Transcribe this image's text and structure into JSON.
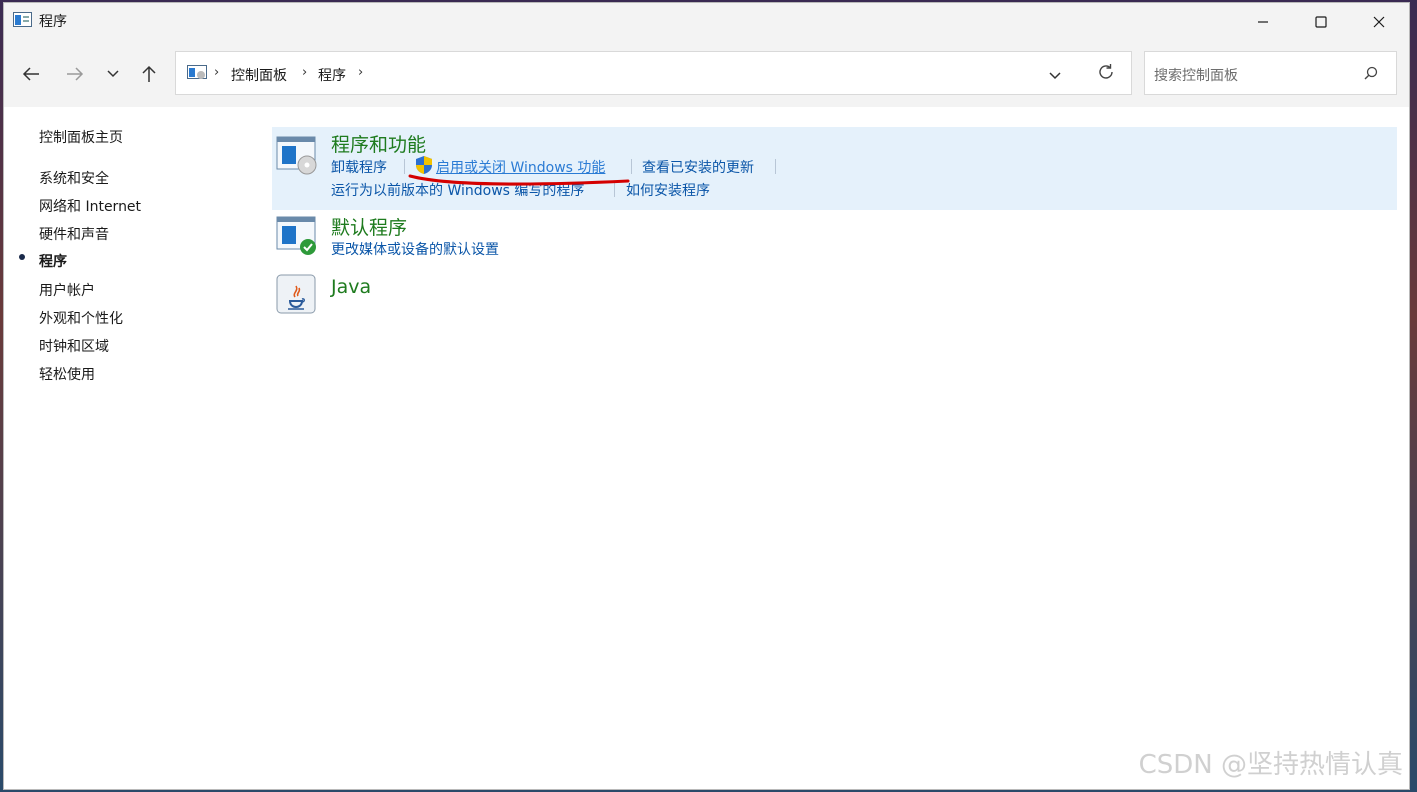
{
  "window": {
    "title": "程序"
  },
  "title_controls": [
    "minimize-icon",
    "maximize-icon",
    "close-icon"
  ],
  "nav": {
    "icons": [
      "back-arrow-icon",
      "forward-arrow-icon",
      "chevron-down-icon",
      "up-arrow-icon"
    ]
  },
  "address": {
    "crumbs": [
      "控制面板",
      "程序"
    ],
    "icons": [
      "control-panel-icon",
      "chevron-down-icon",
      "refresh-icon"
    ]
  },
  "search": {
    "placeholder": "搜索控制面板",
    "icon": "search-icon"
  },
  "sidebar": {
    "items": [
      {
        "label": "控制面板主页"
      },
      {
        "label": "系统和安全"
      },
      {
        "label": "网络和 Internet"
      },
      {
        "label": "硬件和声音"
      },
      {
        "label": "程序",
        "current": true
      },
      {
        "label": "用户帐户"
      },
      {
        "label": "外观和个性化"
      },
      {
        "label": "时钟和区域"
      },
      {
        "label": "轻松使用"
      }
    ]
  },
  "sections": [
    {
      "title": "程序和功能",
      "icon": "programs-features-icon",
      "links": [
        "卸载程序",
        "启用或关闭 Windows 功能",
        "查看已安装的更新",
        "运行为以前版本的 Windows 编写的程序",
        "如何安装程序"
      ],
      "shield_icon": "uac-shield-icon",
      "annotation": "red-underline"
    },
    {
      "title": "默认程序",
      "icon": "default-programs-icon",
      "links": [
        "更改媒体或设备的默认设置"
      ]
    },
    {
      "title": "Java",
      "icon": "java-icon",
      "links": []
    }
  ],
  "colors": {
    "link": "#0b56a8",
    "section_title": "#1e7b1e",
    "highlight": "#e5f1fb",
    "annotation": "#d40000"
  },
  "watermark": "CSDN @坚持热情认真"
}
